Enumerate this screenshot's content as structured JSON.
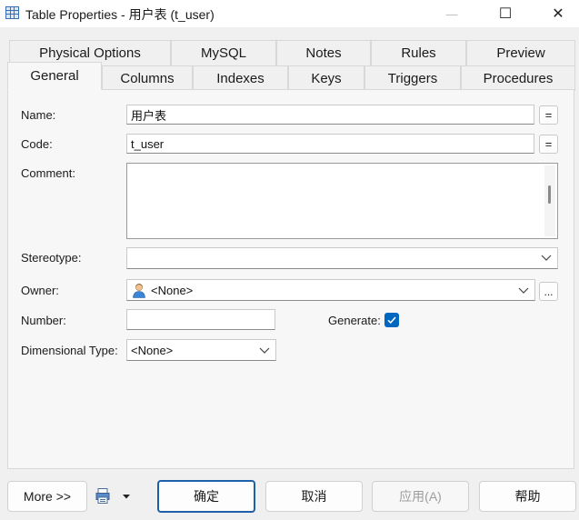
{
  "window": {
    "title": "Table Properties - 用户表 (t_user)",
    "minimize_glyph": "—",
    "maximize_glyph": "☐",
    "close_glyph": "✕"
  },
  "tabs": {
    "row1": [
      "Physical Options",
      "MySQL",
      "Notes",
      "Rules",
      "Preview"
    ],
    "row2": [
      "General",
      "Columns",
      "Indexes",
      "Keys",
      "Triggers",
      "Procedures"
    ],
    "active": "General"
  },
  "form": {
    "name_label": "Name:",
    "name_value": "用户表",
    "code_label": "Code:",
    "code_value": "t_user",
    "eq_label": "=",
    "comment_label": "Comment:",
    "comment_value": "",
    "stereotype_label": "Stereotype:",
    "stereotype_value": "",
    "owner_label": "Owner:",
    "owner_value": "<None>",
    "owner_browse_label": "...",
    "number_label": "Number:",
    "number_value": "",
    "generate_label": "Generate:",
    "generate_checked": true,
    "dimensional_label": "Dimensional Type:",
    "dimensional_value": "<None>"
  },
  "footer": {
    "more_label": "More >>",
    "ok_label": "确定",
    "cancel_label": "取消",
    "apply_label": "应用(A)",
    "help_label": "帮助"
  },
  "icons": {
    "app": "table-icon",
    "owner": "user-icon",
    "print": "printer-icon",
    "dropdown": "chevron-down-icon"
  },
  "colors": {
    "accent": "#0067c0",
    "primary_border": "#1d5fa8"
  }
}
